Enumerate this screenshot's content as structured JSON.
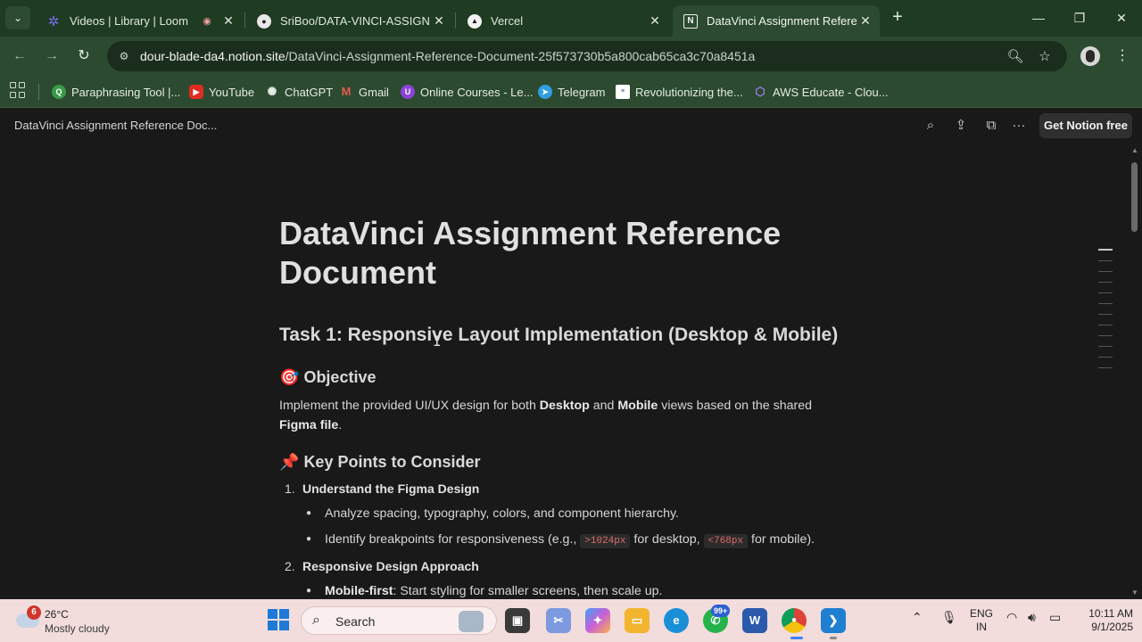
{
  "browser": {
    "tabs": [
      {
        "title": "Videos | Library | Loom",
        "active": false
      },
      {
        "title": "SriBoo/DATA-VINCI-ASSIGNMENT",
        "active": false
      },
      {
        "title": "Vercel",
        "active": false
      },
      {
        "title": "DataVinci Assignment Reference Document",
        "active": true
      }
    ],
    "url_host": "dour-blade-da4.notion.site",
    "url_path": "/DataVinci-Assignment-Reference-Document-25f573730b5a800cab65ca3c70a8451a",
    "bookmarks": [
      {
        "label": "Paraphrasing Tool |...",
        "icon": "quillbot-icon",
        "color": "#3a9a47"
      },
      {
        "label": "YouTube",
        "icon": "youtube-icon",
        "color": "#e02b20"
      },
      {
        "label": "ChatGPT",
        "icon": "chatgpt-icon",
        "color": "#5a5a5a"
      },
      {
        "label": "Gmail",
        "icon": "gmail-icon",
        "color": "#d64537"
      },
      {
        "label": "Online Courses - Le...",
        "icon": "udemy-icon",
        "color": "#8a44d8"
      },
      {
        "label": "Telegram",
        "icon": "telegram-icon",
        "color": "#2f9ee0"
      },
      {
        "label": "Revolutionizing the...",
        "icon": "article-icon",
        "color": "#ffffff"
      },
      {
        "label": "AWS Educate - Clou...",
        "icon": "aws-educate-icon",
        "color": "#7b5cd6"
      }
    ]
  },
  "notion": {
    "breadcrumb": "DataVinci Assignment Reference Doc...",
    "get_notion": "Get Notion free",
    "page_title": "DataVinci Assignment Reference Document",
    "task_heading": "Task 1: Responsive Layout Implementation (Desktop & Mobile)",
    "objective_emoji": "🎯",
    "objective_heading": "Objective",
    "objective_text_1": "Implement the provided UI/UX design for both ",
    "objective_bold_1": "Desktop",
    "objective_text_2": " and ",
    "objective_bold_2": "Mobile",
    "objective_text_3": " views based on the shared ",
    "objective_bold_3": "Figma file",
    "objective_text_4": ".",
    "keypoints_emoji": "📌",
    "keypoints_heading": "Key Points to Consider",
    "ol": [
      {
        "num": "1.",
        "label": "Understand the Figma Design"
      },
      {
        "num": "2.",
        "label": "Responsive Design Approach"
      }
    ],
    "bullet_1": "Analyze spacing, typography, colors, and component hierarchy.",
    "bullet_2_a": "Identify breakpoints for responsiveness (e.g., ",
    "bullet_2_code_1": ">1024px",
    "bullet_2_b": " for desktop, ",
    "bullet_2_code_2": "<768px",
    "bullet_2_c": " for mobile).",
    "bullet_3_bold": "Mobile-first",
    "bullet_3_text": ": Start styling for smaller screens, then scale up."
  },
  "taskbar": {
    "weather_badge": "6",
    "weather_temp": "26°C",
    "weather_desc": "Mostly cloudy",
    "search_label": "Search",
    "whatsapp_badge": "99+",
    "lang_1": "ENG",
    "lang_2": "IN",
    "time": "10:11 AM",
    "date": "9/1/2025"
  }
}
